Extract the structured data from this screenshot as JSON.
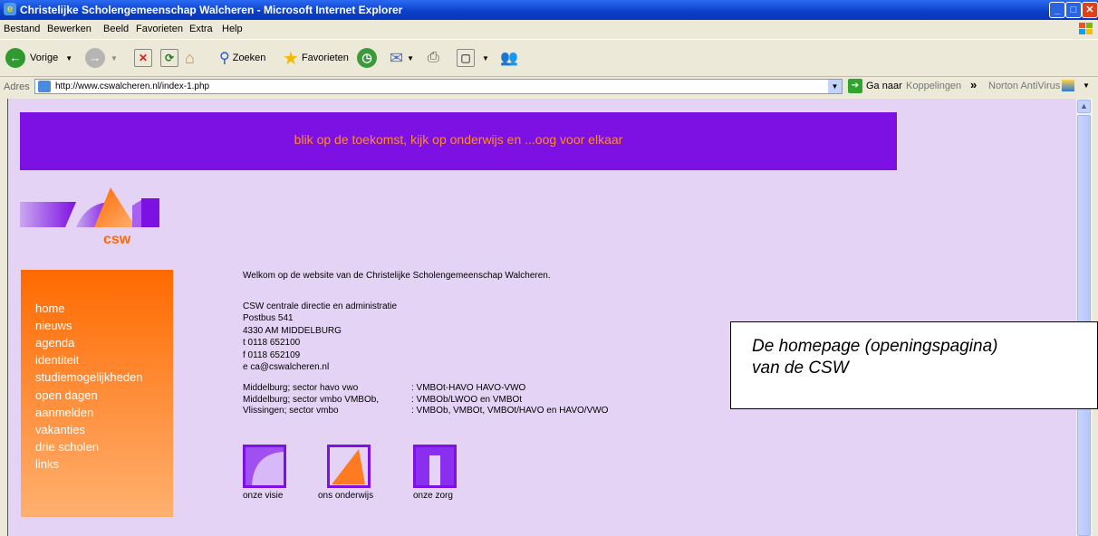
{
  "window": {
    "title": "Christelijke Scholengemeenschap Walcheren - Microsoft Internet Explorer"
  },
  "menu": [
    "Bestand",
    "Bewerken",
    "Beeld",
    "Favorieten",
    "Extra",
    "Help"
  ],
  "toolbar": {
    "back": "Vorige",
    "search": "Zoeken",
    "favorites": "Favorieten"
  },
  "address": {
    "label": "Adres",
    "url": "http://www.cswalcheren.nl/index-1.php",
    "go": "Ga naar",
    "links": "Koppelingen",
    "more": "»",
    "norton": "Norton AntiVirus"
  },
  "page": {
    "banner": "blik op de toekomst, kijk op onderwijs en ...oog voor elkaar",
    "logo_text": "csw",
    "nav": [
      "home",
      "nieuws",
      "agenda",
      "identiteit",
      "studiemogelijkheden",
      "open dagen",
      "aanmelden",
      "vakanties",
      "drie scholen",
      "links"
    ],
    "welcome": "Welkom op de website van de Christelijke Scholengemeenschap Walcheren.",
    "address_lines": [
      "CSW centrale directie en administratie",
      "Postbus 541",
      "4330 AM MIDDELBURG",
      "t 0118 652100",
      "f 0118 652109",
      "e ca@cswalcheren.nl"
    ],
    "schools": [
      {
        "location": "Middelburg; sector havo vwo",
        "types": ": VMBOt-HAVO HAVO-VWO"
      },
      {
        "location": "Middelburg; sector vmbo VMBOb,",
        "types": ": VMBOb/LWOO en VMBOt"
      },
      {
        "location": "Vlissingen; sector vmbo",
        "types": ": VMBOb, VMBOt, VMBOt/HAVO en HAVO/VWO"
      }
    ],
    "icons": [
      "onze visie",
      "ons onderwijs",
      "onze zorg"
    ]
  },
  "callout": {
    "line1": "De homepage (openingspagina)",
    "line2": "van de CSW"
  },
  "colors": {
    "page_bg": "#e5d3f6",
    "banner_bg": "#7d10e3",
    "banner_text": "#ff8a2a",
    "sidebar_top": "#ff6a00",
    "sidebar_bottom": "#ffb070"
  }
}
